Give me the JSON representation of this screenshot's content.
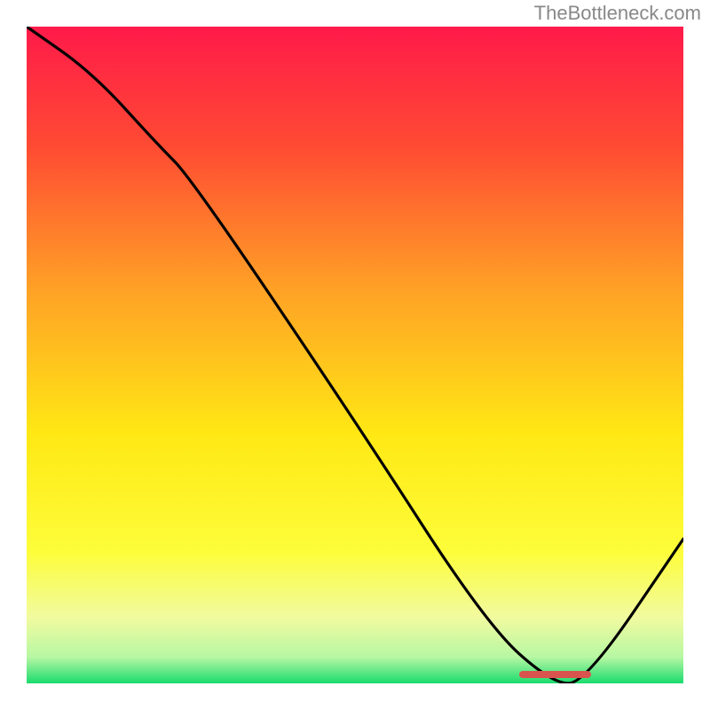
{
  "watermark": "TheBottleneck.com",
  "chart_data": {
    "type": "line",
    "title": "",
    "xlabel": "",
    "ylabel": "",
    "xlim": [
      0,
      100
    ],
    "ylim": [
      0,
      100
    ],
    "series": [
      {
        "name": "bottleneck-curve",
        "x": [
          0,
          10,
          20,
          25,
          50,
          70,
          80,
          85,
          100
        ],
        "values": [
          100,
          93,
          82,
          77,
          40,
          9,
          0,
          0,
          22
        ]
      }
    ],
    "background_gradient_stops": [
      {
        "pct": 0,
        "color": "#ff1a4a"
      },
      {
        "pct": 18,
        "color": "#ff4a33"
      },
      {
        "pct": 40,
        "color": "#ffa126"
      },
      {
        "pct": 62,
        "color": "#ffe814"
      },
      {
        "pct": 80,
        "color": "#fdfd3a"
      },
      {
        "pct": 90,
        "color": "#f1fba0"
      },
      {
        "pct": 96,
        "color": "#b7f7a3"
      },
      {
        "pct": 100,
        "color": "#1adb6e"
      }
    ],
    "optimal_zone": {
      "x_start": 75,
      "x_end": 86,
      "y": 0.5
    }
  }
}
